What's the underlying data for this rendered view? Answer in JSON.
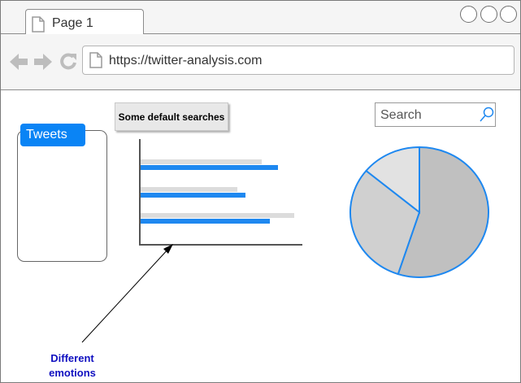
{
  "browser": {
    "tab_title": "Page 1",
    "url": "https://twitter-analysis.com",
    "window_buttons": [
      "minimize",
      "maximize",
      "close"
    ]
  },
  "tweets_panel": {
    "title": "Tweets"
  },
  "toolbar": {
    "default_searches_label": "Some default searches"
  },
  "search": {
    "placeholder": "Search"
  },
  "annotation": {
    "label": "Different emotions"
  },
  "colors": {
    "accent": "#0a84f5",
    "bar_primary": "#1e88f0",
    "bar_secondary": "#dcdcdc",
    "pie_stroke": "#1e88f0",
    "pie_slices": [
      "#c0c0c0",
      "#d0d0d0",
      "#e2e2e2"
    ],
    "annotation_text": "#1010c0"
  },
  "chart_data": [
    {
      "type": "bar",
      "orientation": "horizontal",
      "series": [
        {
          "values": [
            75,
            60,
            95
          ]
        },
        {
          "values": [
            85,
            65,
            80
          ]
        }
      ],
      "xlim": [
        0,
        100
      ],
      "grid": false
    },
    {
      "type": "pie",
      "values": [
        55,
        31,
        14
      ]
    }
  ]
}
